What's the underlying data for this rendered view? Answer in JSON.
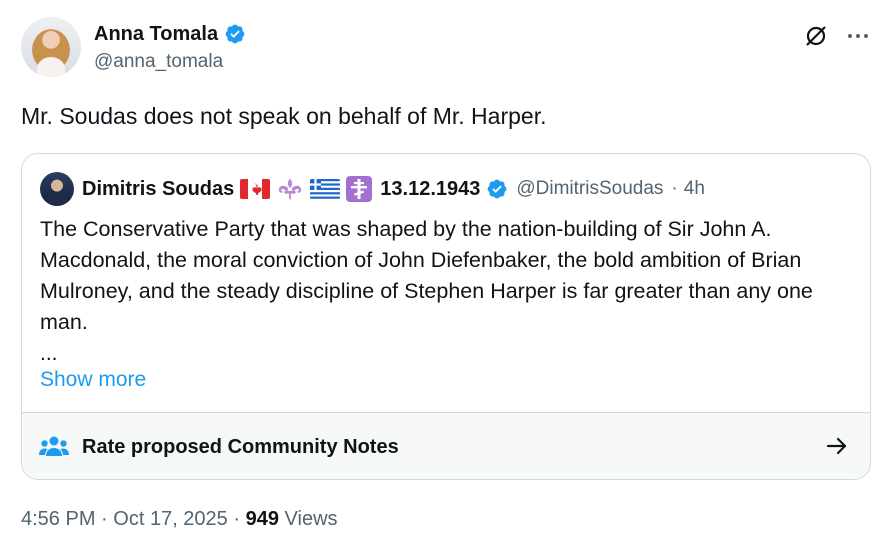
{
  "author": {
    "display_name": "Anna Tomala",
    "handle": "@anna_tomala",
    "verified": true
  },
  "tweet": {
    "text": "Mr. Soudas does not speak on behalf of Mr. Harper."
  },
  "quoted": {
    "display_name": "Dimitris Soudas",
    "date_label": "13.12.1943",
    "handle": "@DimitrisSoudas",
    "separator": "·",
    "time": "4h",
    "body": "The Conservative Party that was shaped by the nation-building of Sir John A. Macdonald, the moral conviction of John Diefenbaker, the bold ambition of Brian Mulroney, and the steady discipline of Stephen Harper is far greater than any one man.",
    "ellipsis": "...",
    "show_more": "Show more",
    "flags": [
      "canada-flag",
      "fleur-de-lis-icon",
      "greece-flag",
      "orthodox-cross-icon"
    ]
  },
  "community_notes": {
    "label": "Rate proposed Community Notes"
  },
  "meta": {
    "time": "4:56 PM",
    "date": "Oct 17, 2025",
    "sep": "·",
    "views_count": "949",
    "views_label": "Views"
  },
  "colors": {
    "text": "#0f1419",
    "secondary": "#536471",
    "accent": "#1d9bf0",
    "border": "#cfd9de"
  }
}
